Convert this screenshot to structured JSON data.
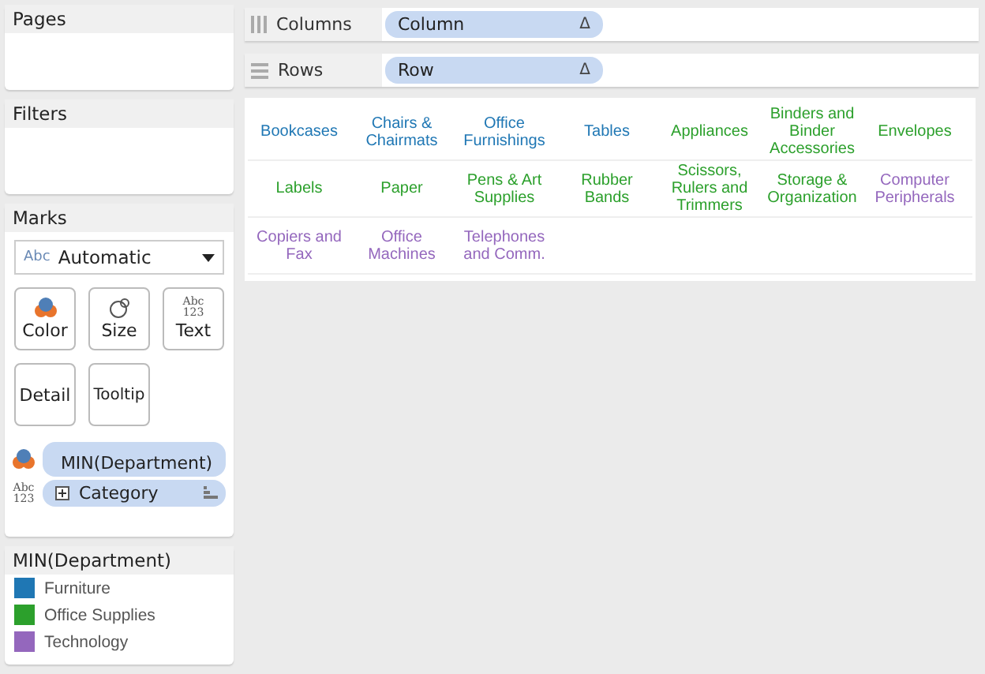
{
  "pages_panel": {
    "title": "Pages"
  },
  "filters_panel": {
    "title": "Filters"
  },
  "marks_panel": {
    "title": "Marks",
    "mark_type": {
      "icon_text": "Abc",
      "value": "Automatic"
    },
    "buttons": [
      {
        "kind": "color",
        "label": "Color"
      },
      {
        "kind": "size",
        "label": "Size"
      },
      {
        "kind": "text",
        "label": "Text",
        "icon_text": [
          "Abc",
          "123"
        ]
      },
      {
        "kind": "plain",
        "label": "Detail"
      },
      {
        "kind": "plain",
        "label": "Tooltip"
      }
    ],
    "fields": [
      {
        "kind": "color",
        "label": "MIN(Department)"
      },
      {
        "kind": "text",
        "label": "Category",
        "icon_text": [
          "Abc",
          "123"
        ],
        "expandable": true,
        "sorted": true
      }
    ]
  },
  "legend": {
    "title": "MIN(Department)",
    "items": [
      {
        "label": "Furniture",
        "color": "#1f77b4"
      },
      {
        "label": "Office Supplies",
        "color": "#2ca02c"
      },
      {
        "label": "Technology",
        "color": "#9467bd"
      }
    ]
  },
  "shelves": [
    {
      "kind": "columns",
      "label": "Columns",
      "pill": "Column",
      "pill_icon": "Δ"
    },
    {
      "kind": "rows",
      "label": "Rows",
      "pill": "Row",
      "pill_icon": "Δ"
    }
  ],
  "view": {
    "rows": [
      [
        {
          "text": "Bookcases",
          "color": "#1f77b4"
        },
        {
          "text": "Chairs & Chairmats",
          "color": "#1f77b4"
        },
        {
          "text": "Office Furnishings",
          "color": "#1f77b4"
        },
        {
          "text": "Tables",
          "color": "#1f77b4"
        },
        {
          "text": "Appliances",
          "color": "#2ca02c"
        },
        {
          "text": "Binders and Binder Accessories",
          "color": "#2ca02c"
        },
        {
          "text": "Envelopes",
          "color": "#2ca02c"
        }
      ],
      [
        {
          "text": "Labels",
          "color": "#2ca02c"
        },
        {
          "text": "Paper",
          "color": "#2ca02c"
        },
        {
          "text": "Pens & Art Supplies",
          "color": "#2ca02c"
        },
        {
          "text": "Rubber Bands",
          "color": "#2ca02c"
        },
        {
          "text": "Scissors, Rulers and Trimmers",
          "color": "#2ca02c"
        },
        {
          "text": "Storage & Organization",
          "color": "#2ca02c"
        },
        {
          "text": "Computer Peripherals",
          "color": "#9467bd"
        }
      ],
      [
        {
          "text": "Copiers and Fax",
          "color": "#9467bd"
        },
        {
          "text": "Office Machines",
          "color": "#9467bd"
        },
        {
          "text": "Telephones and Comm.",
          "color": "#9467bd"
        }
      ]
    ]
  }
}
